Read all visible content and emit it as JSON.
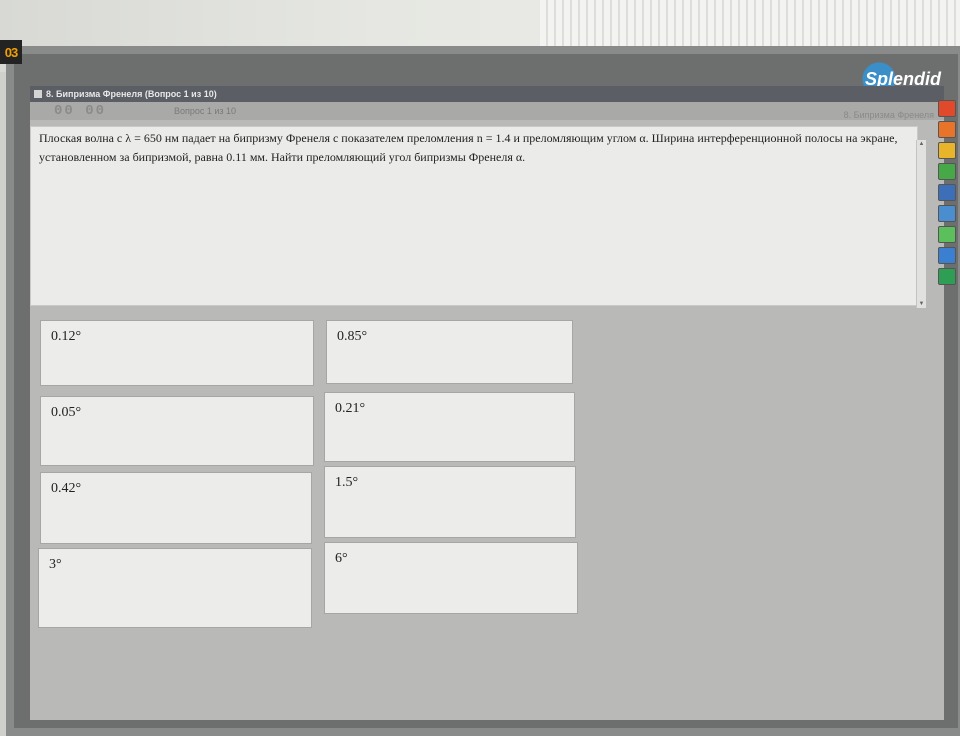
{
  "window": {
    "title": "8. Бипризма Френеля (Вопрос 1 из 10)",
    "timer": "00 00",
    "question_counter": "Вопрос 1 из 10",
    "topic": "8. Бипризма Френеля"
  },
  "question": {
    "text": "Плоская волна с λ = 650 нм падает на бипризму Френеля с показателем преломления n = 1.4 и преломляющим углом α. Ширина интерференционной полосы на экране, установленном за бипризмой, равна 0.11 мм. Найти преломляющий угол бипризмы Френеля α."
  },
  "answers": [
    "0.12°",
    "0.85°",
    "0.05°",
    "0.21°",
    "0.42°",
    "1.5°",
    "3°",
    "6°"
  ],
  "monitor": {
    "brand": "Splendid",
    "sticker": "03"
  },
  "sidebar": {
    "buttons": [
      {
        "icon": "stop-icon",
        "color": "#e04a2a"
      },
      {
        "icon": "document-icon",
        "color": "#e8742a"
      },
      {
        "icon": "folder-icon",
        "color": "#e8b42a"
      },
      {
        "icon": "image-icon",
        "color": "#46a847"
      },
      {
        "icon": "graph-icon",
        "color": "#3d6fb8"
      },
      {
        "icon": "people-icon",
        "color": "#4a8ed0"
      },
      {
        "icon": "chart-icon",
        "color": "#5bbf5b"
      },
      {
        "icon": "grid-icon",
        "color": "#3a7fd0"
      },
      {
        "icon": "globe-icon",
        "color": "#2e9e55"
      }
    ]
  }
}
